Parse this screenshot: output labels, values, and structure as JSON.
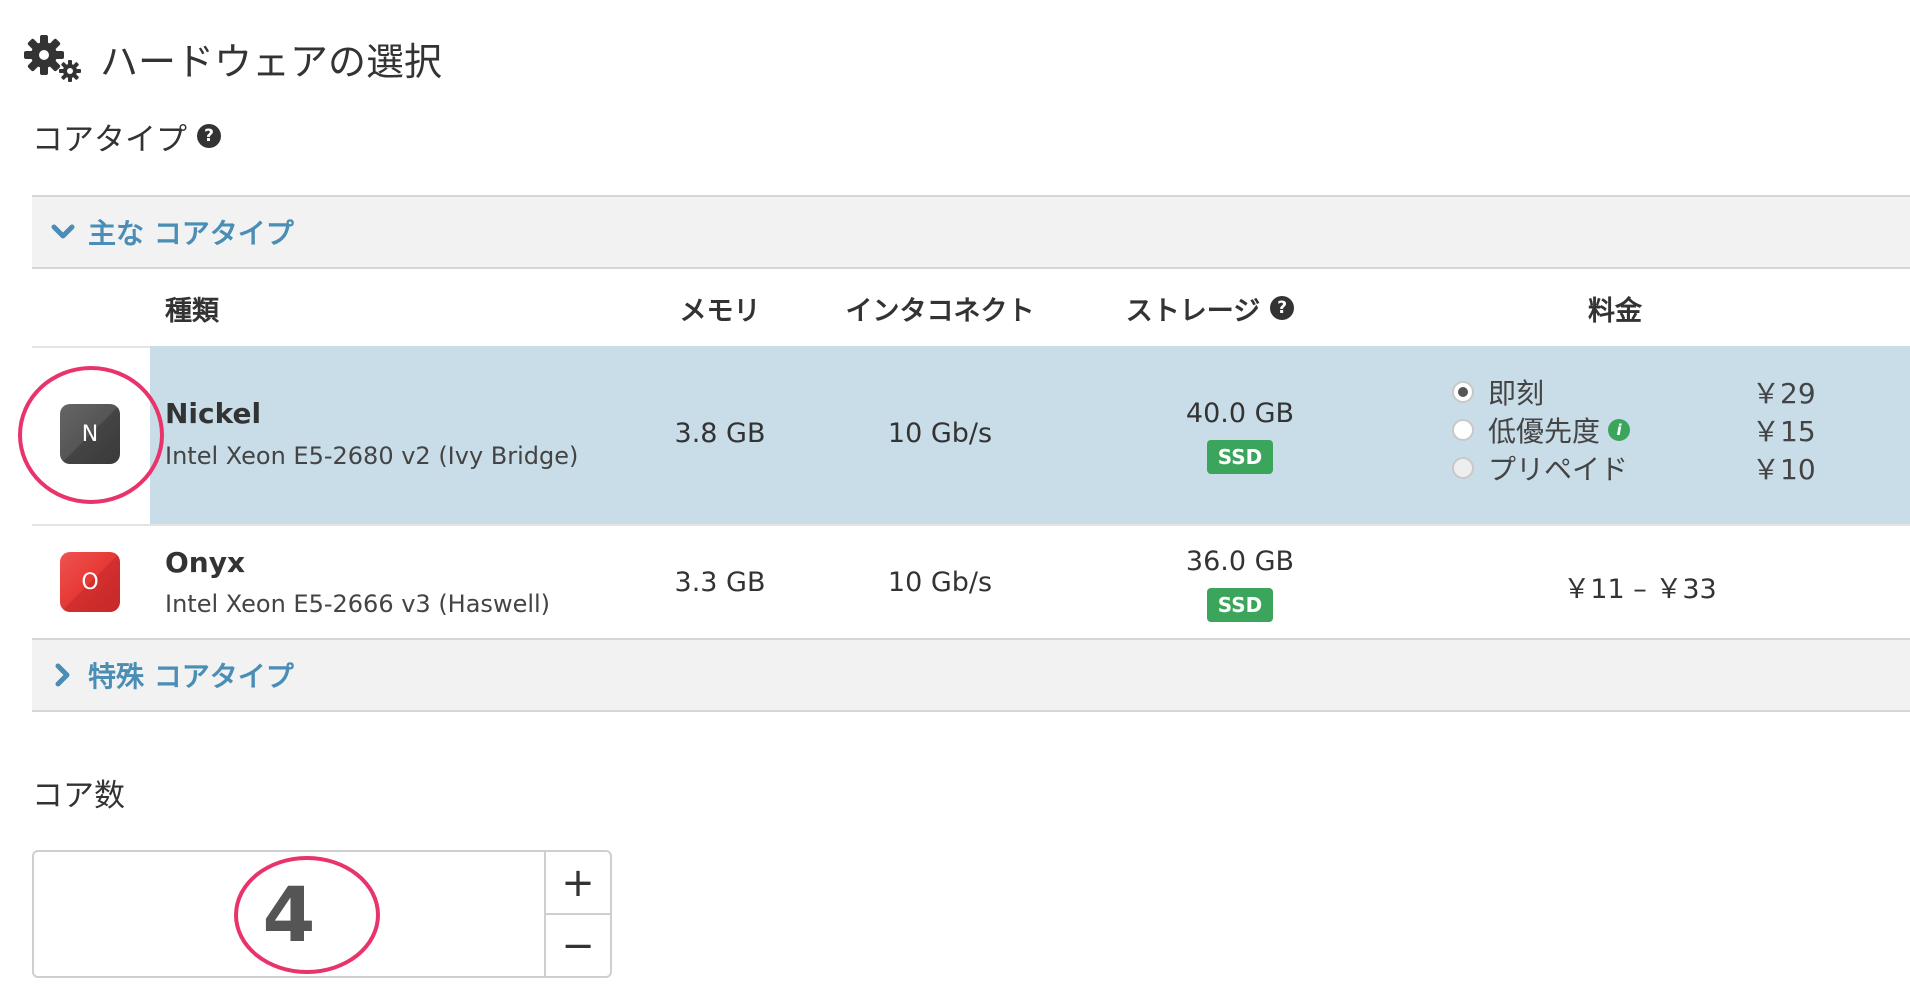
{
  "page": {
    "title": "ハードウェアの選択"
  },
  "core_type": {
    "label": "コアタイプ",
    "help": "?",
    "main_group": "主な コアタイプ",
    "special_group": "特殊 コアタイプ",
    "columns": {
      "kind": "種類",
      "memory": "メモリ",
      "interconnect": "インタコネクト",
      "storage": "ストレージ",
      "storage_help": "?",
      "price": "料金"
    },
    "rows": [
      {
        "icon_letter": "N",
        "name": "Nickel",
        "cpu": "Intel Xeon E5-2680 v2 (Ivy Bridge)",
        "memory": "3.8 GB",
        "interconnect": "10 Gb/s",
        "storage": "40.0 GB",
        "storage_badge": "SSD",
        "selected": true,
        "prices": [
          {
            "label": "即刻",
            "value": "￥29",
            "checked": true
          },
          {
            "label": "低優先度",
            "value": "￥15",
            "checked": false,
            "info": "i"
          },
          {
            "label": "プリペイド",
            "value": "￥10",
            "checked": false
          }
        ]
      },
      {
        "icon_letter": "O",
        "name": "Onyx",
        "cpu": "Intel Xeon E5-2666 v3 (Haswell)",
        "memory": "3.3 GB",
        "interconnect": "10 Gb/s",
        "storage": "36.0 GB",
        "storage_badge": "SSD",
        "selected": false,
        "price_range": "￥11 – ￥33"
      }
    ]
  },
  "core_count": {
    "label": "コア数",
    "value": "4",
    "plus": "+",
    "minus": "−"
  },
  "colors": {
    "accent": "#4a8db5",
    "selected_row": "#c9dde8",
    "badge": "#3ba55c",
    "annotation": "#e8336b"
  }
}
